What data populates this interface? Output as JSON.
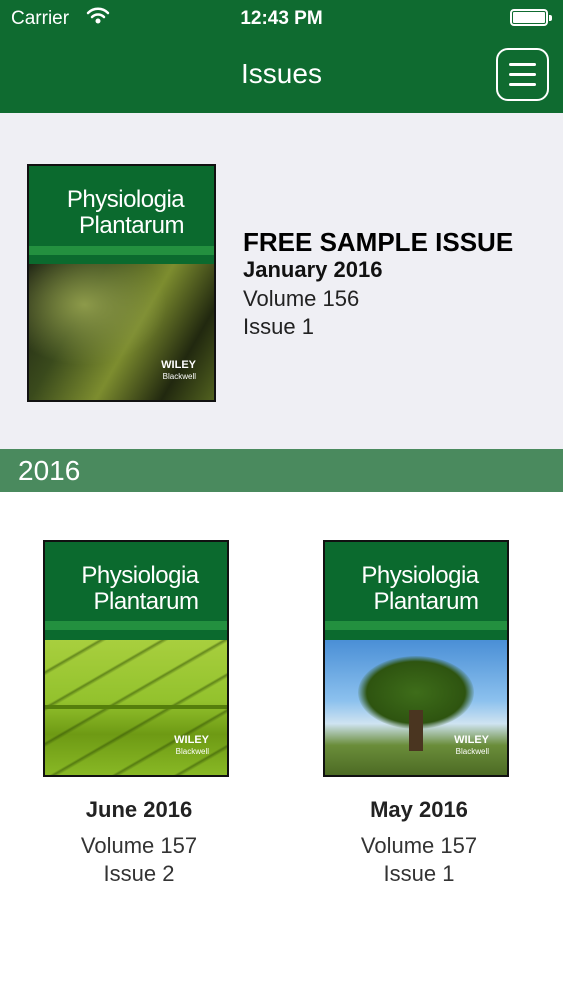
{
  "status_bar": {
    "carrier": "Carrier",
    "time": "12:43 PM",
    "wifi_icon": "wifi-icon",
    "battery_icon": "battery-icon"
  },
  "nav": {
    "title": "Issues",
    "menu_icon": "hamburger-menu-icon"
  },
  "cover": {
    "title_line1": "Physiologia",
    "title_line2": "Plantarum",
    "publisher": "WILEY",
    "publisher_sub": "Blackwell"
  },
  "featured": {
    "label": "FREE SAMPLE ISSUE",
    "date": "January 2016",
    "volume": "Volume 156",
    "issue": "Issue 1"
  },
  "section": {
    "year": "2016"
  },
  "issues": [
    {
      "date": "June 2016",
      "volume": "Volume 157",
      "issue": "Issue 2"
    },
    {
      "date": "May 2016",
      "volume": "Volume 157",
      "issue": "Issue 1"
    }
  ],
  "colors": {
    "nav_bg": "#0f6b30",
    "section_bar": "#4a8a5e",
    "featured_bg": "#efeff4"
  }
}
